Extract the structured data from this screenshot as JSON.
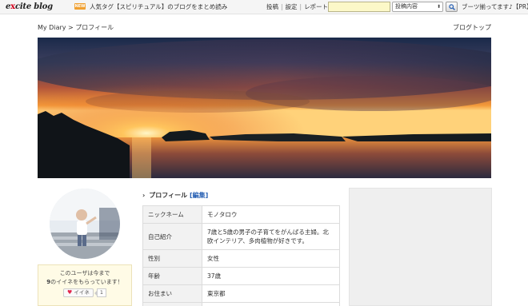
{
  "topbar": {
    "logo_prefix": "e",
    "logo_x": "x",
    "logo_rest": "cite blog",
    "new_badge": "NEW",
    "promo": "人気タグ【スピリチュアル】のブログをまとめ読み",
    "nav": [
      "投稿",
      "設定",
      "レポート"
    ],
    "search_placeholder": "",
    "search_scope": "投稿内容",
    "pr_text": "ブーツ揃ってます♪【PR】"
  },
  "breadcrumb": "My Diary > プロフィール",
  "blog_top_link": "ブログトップ",
  "like_box": {
    "line1": "このユーザは今まで",
    "line2_count": "9",
    "line2_text": "のイイネをもらっています！",
    "button_label": "イイネ",
    "count": "1"
  },
  "profile": {
    "heading": "プロフィール",
    "edit_label": "[編集]",
    "rows": [
      {
        "key": "ニックネーム",
        "value": "モノタロウ"
      },
      {
        "key": "自己紹介",
        "value": "7歳と5歳の男子の子育てをがんばる主婦。北欧インテリア、多肉植物が好きです。"
      },
      {
        "key": "性別",
        "value": "女性"
      },
      {
        "key": "年齢",
        "value": "37歳"
      },
      {
        "key": "お住まい",
        "value": "東京都"
      },
      {
        "key": "",
        "value": ""
      }
    ]
  },
  "colors": {
    "accent_link": "#2a62b4",
    "search_bg": "#fcf8c8",
    "like_box_bg": "#fffbe6",
    "sidebar_bg": "#efefef"
  }
}
